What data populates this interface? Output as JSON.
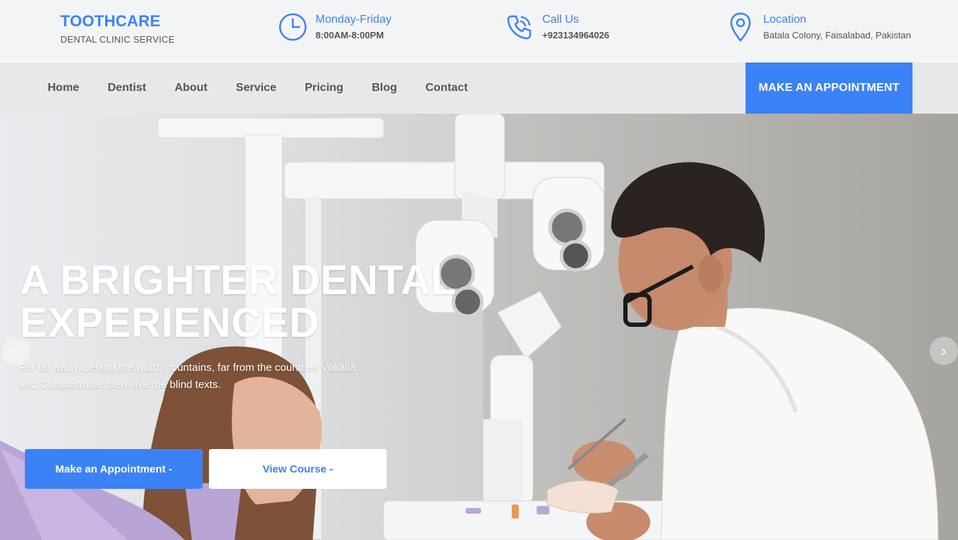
{
  "brand": {
    "name": "TOOTHCARE",
    "tagline": "DENTAL CLINIC SERVICE"
  },
  "info": {
    "hours": {
      "icon": "clock-icon",
      "title": "Monday-Friday",
      "value": "8:00AM-8:00PM"
    },
    "call": {
      "icon": "phone-icon",
      "title": "Call Us",
      "value": "+923134964026"
    },
    "location": {
      "icon": "map-pin-icon",
      "title": "Location",
      "value": "Batala Colony, Faisalabad, Pakistan"
    }
  },
  "nav": {
    "items": [
      "Home",
      "Dentist",
      "About",
      "Service",
      "Pricing",
      "Blog",
      "Contact"
    ],
    "cta": "MAKE AN APPOINTMENT"
  },
  "hero": {
    "title_line1": "A BRIGHTER DENTAL",
    "title_line2": "EXPERIENCED",
    "text": "Far far away, behind the word mountains, far from the countries Vokalia and Consonantia, there live the blind texts.",
    "primary_button": "Make an Appointment -",
    "secondary_button": "View Course -",
    "prev_arrow": "‹",
    "next_arrow": "›"
  },
  "colors": {
    "accent": "#3b82f6",
    "text_muted": "#555555",
    "topbar_bg": "#f3f4f6",
    "navbar_bg": "#e7e8ea"
  }
}
